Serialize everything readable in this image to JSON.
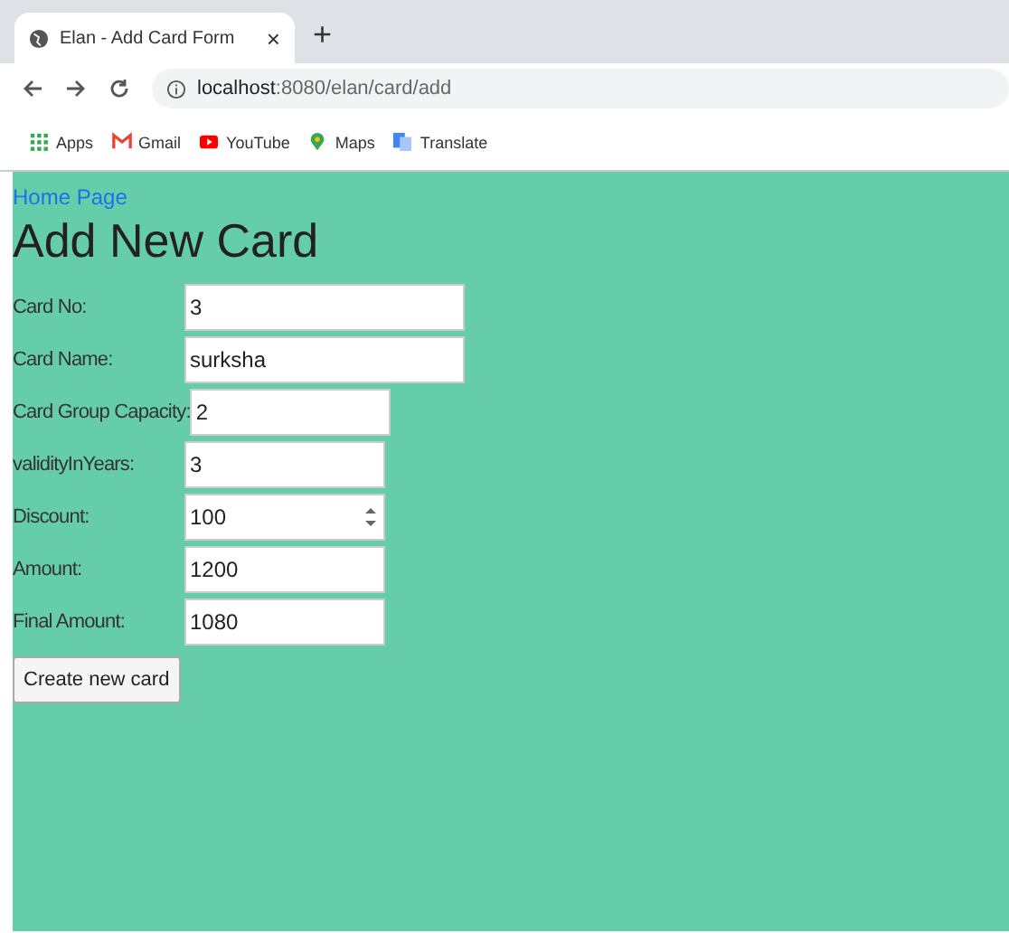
{
  "browser": {
    "tab": {
      "title": "Elan - Add Card Form",
      "close": "×"
    },
    "new_tab": "+",
    "address": {
      "host": "localhost",
      "rest": ":8080/elan/card/add"
    },
    "bookmarks": [
      {
        "kind": "apps",
        "label": "Apps"
      },
      {
        "kind": "gmail",
        "label": "Gmail"
      },
      {
        "kind": "youtube",
        "label": "YouTube"
      },
      {
        "kind": "maps",
        "label": "Maps"
      },
      {
        "kind": "translate",
        "label": "Translate"
      }
    ]
  },
  "page": {
    "home_link": "Home Page",
    "heading": "Add New Card",
    "fields": [
      {
        "label": "Card No:",
        "value": "3",
        "kind": "text",
        "spinner": false
      },
      {
        "label": "Card Name:",
        "value": "surksha",
        "kind": "text",
        "spinner": false
      },
      {
        "label": "Card Group Capacity:",
        "value": "2",
        "kind": "number",
        "spinner": false
      },
      {
        "label": "validityInYears:",
        "value": "3",
        "kind": "number",
        "spinner": false
      },
      {
        "label": "Discount:",
        "value": "100",
        "kind": "number",
        "spinner": true
      },
      {
        "label": "Amount:",
        "value": "1200",
        "kind": "number",
        "spinner": false
      },
      {
        "label": "Final Amount:",
        "value": "1080",
        "kind": "number",
        "spinner": false
      }
    ],
    "submit": "Create new card"
  }
}
